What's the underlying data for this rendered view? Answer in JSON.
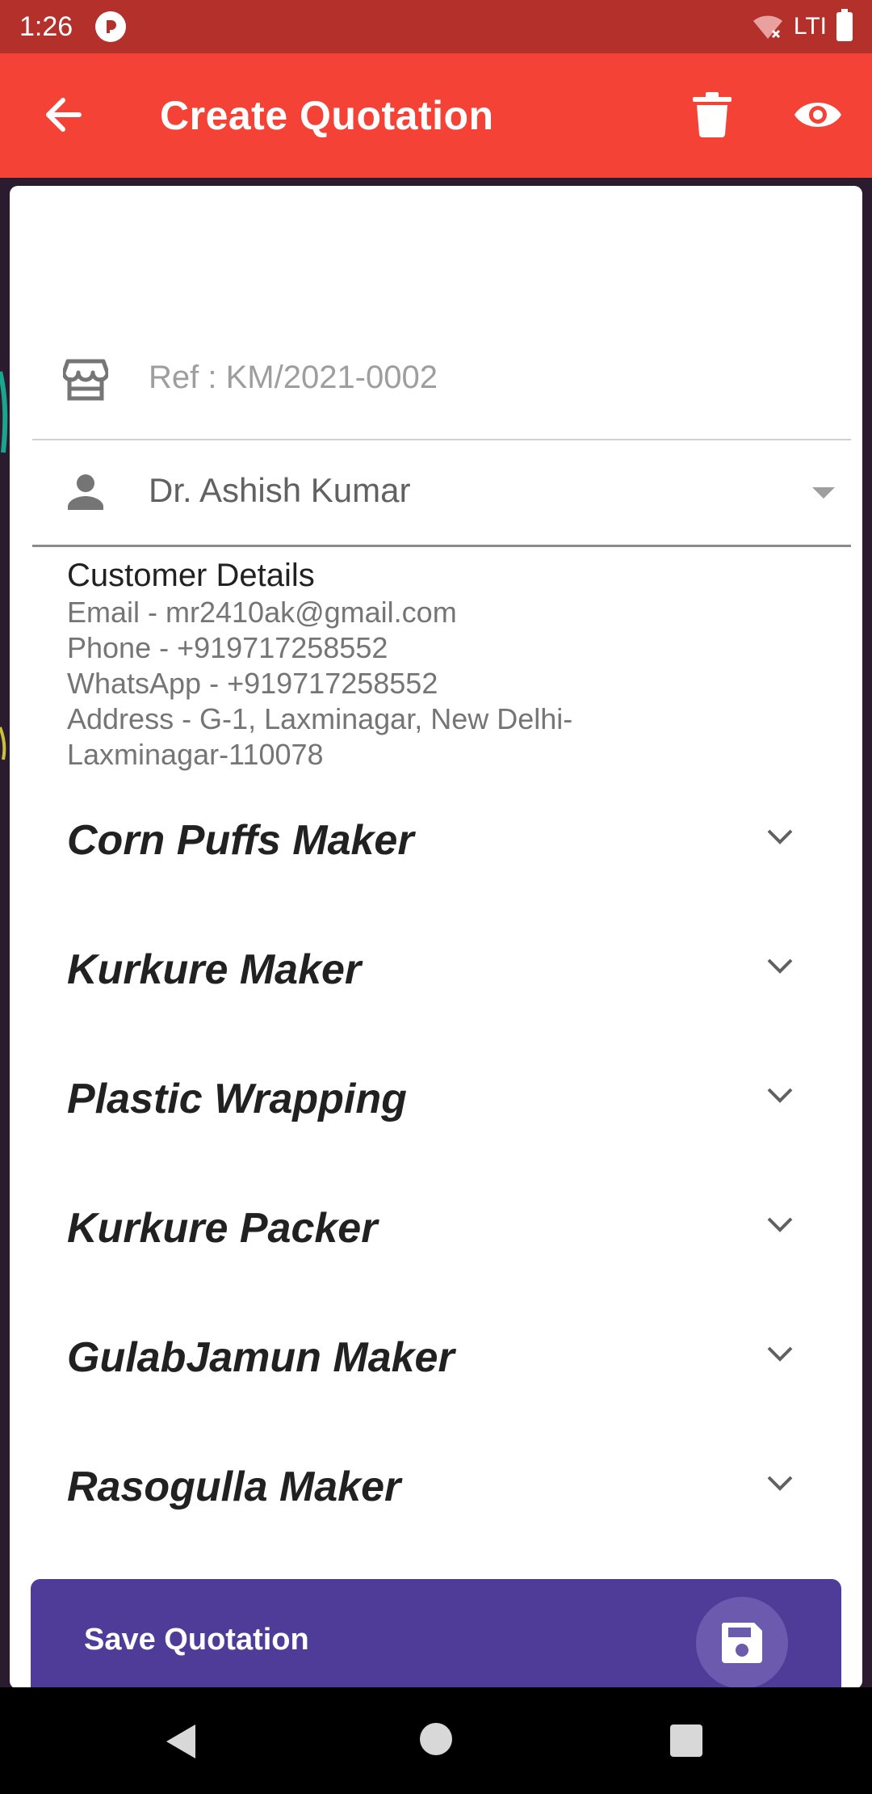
{
  "status_bar": {
    "time": "1:26",
    "network": "LTI"
  },
  "app_bar": {
    "title": "Create Quotation"
  },
  "form": {
    "ref": "Ref : KM/2021-0002",
    "customer_name": "Dr. Ashish Kumar"
  },
  "customer_details": {
    "title": "Customer Details",
    "lines": [
      "Email - mr2410ak@gmail.com",
      "Phone - +919717258552",
      "WhatsApp - +919717258552",
      "Address - G-1, Laxminagar, New Delhi-",
      "Laxminagar-110078"
    ]
  },
  "products": [
    "Corn Puffs Maker",
    "Kurkure Maker",
    "Plastic Wrapping",
    "Kurkure Packer",
    "GulabJamun Maker",
    "Rasogulla Maker"
  ],
  "save_bar": {
    "label": "Save Quotation"
  },
  "colors": {
    "status_bar": "#b3302b",
    "app_bar": "#f44336",
    "save_bar": "#4f3c99"
  }
}
